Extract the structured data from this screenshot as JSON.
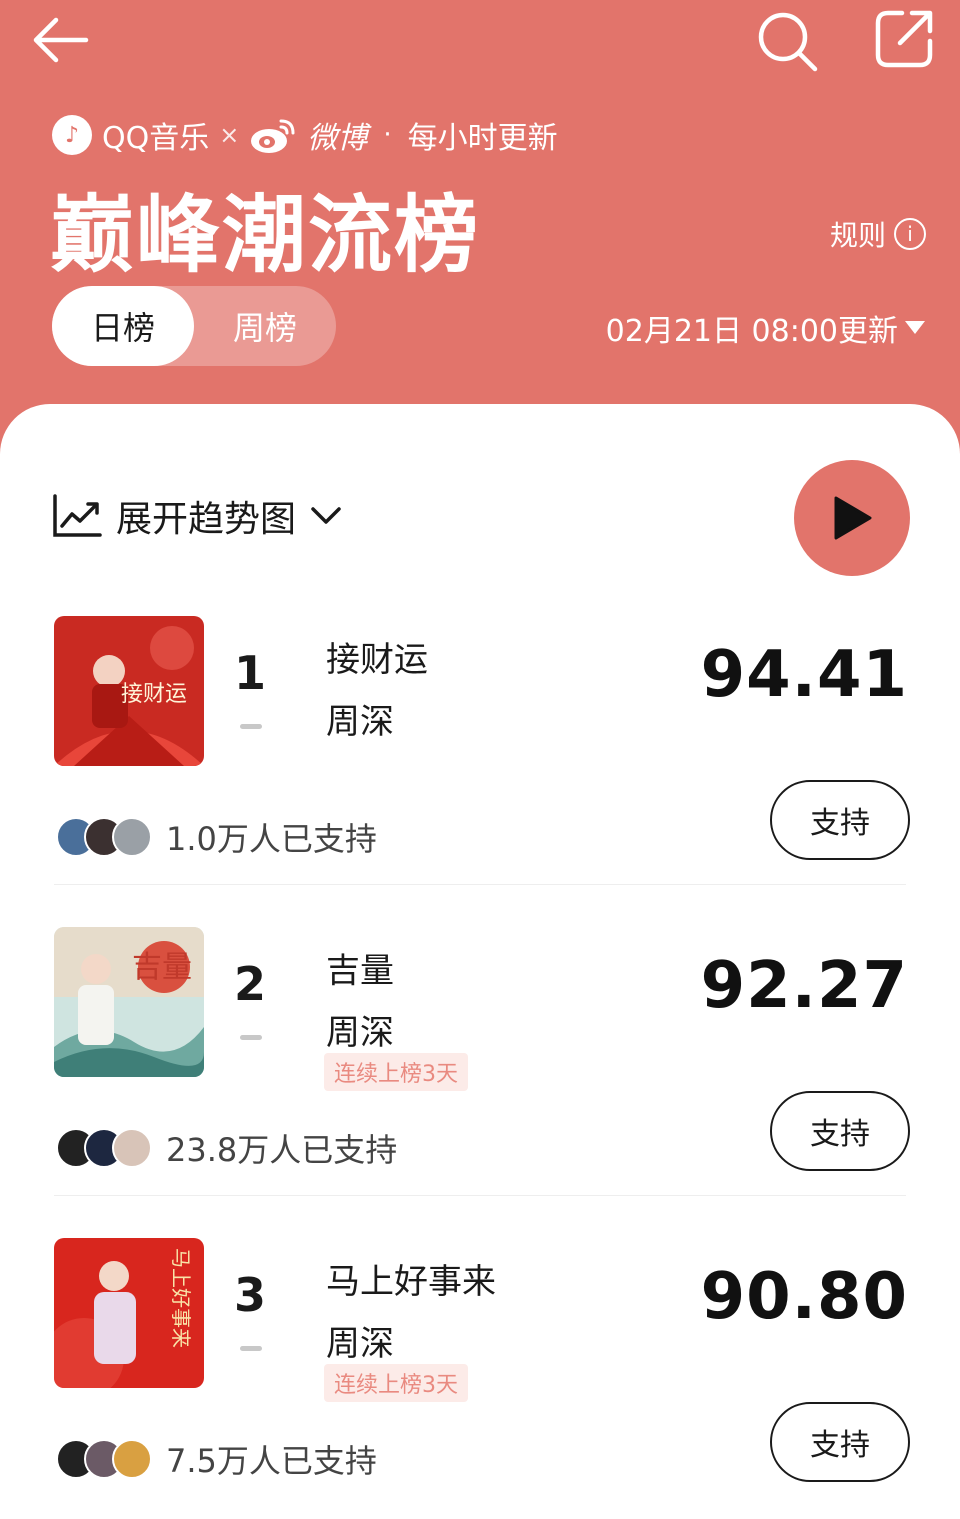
{
  "nav": {
    "back_icon": "arrow-left-icon",
    "search_icon": "search-icon",
    "share_icon": "share-icon"
  },
  "header": {
    "source_qq": "QQ音乐",
    "source_times": "×",
    "source_weibo": "微博",
    "source_dot": "·",
    "update_freq": "每小时更新",
    "title": "巅峰潮流榜",
    "rules_label": "规则",
    "tabs": [
      {
        "label": "日榜",
        "active": true
      },
      {
        "label": "周榜",
        "active": false
      }
    ],
    "update_time": "02月21日 08:00更新"
  },
  "controls": {
    "trend_label": "展开趋势图"
  },
  "entries": [
    {
      "rank": "1",
      "title": "接财运",
      "artist": "周深",
      "streak": "",
      "score": "94.41",
      "supporters": "1.0万人已支持",
      "support_label": "支持",
      "cover_text": "接财运"
    },
    {
      "rank": "2",
      "title": "吉量",
      "artist": "周深",
      "streak": "连续上榜3天",
      "score": "92.27",
      "supporters": "23.8万人已支持",
      "support_label": "支持",
      "cover_text": "吉量"
    },
    {
      "rank": "3",
      "title": "马上好事来",
      "artist": "周深",
      "streak": "连续上榜3天",
      "score": "90.80",
      "supporters": "7.5万人已支持",
      "support_label": "支持",
      "cover_text": "马上好事来"
    }
  ],
  "colors": {
    "accent": "#e2746b",
    "streak_bg": "#fcebe8",
    "streak_text": "#e98a80"
  }
}
